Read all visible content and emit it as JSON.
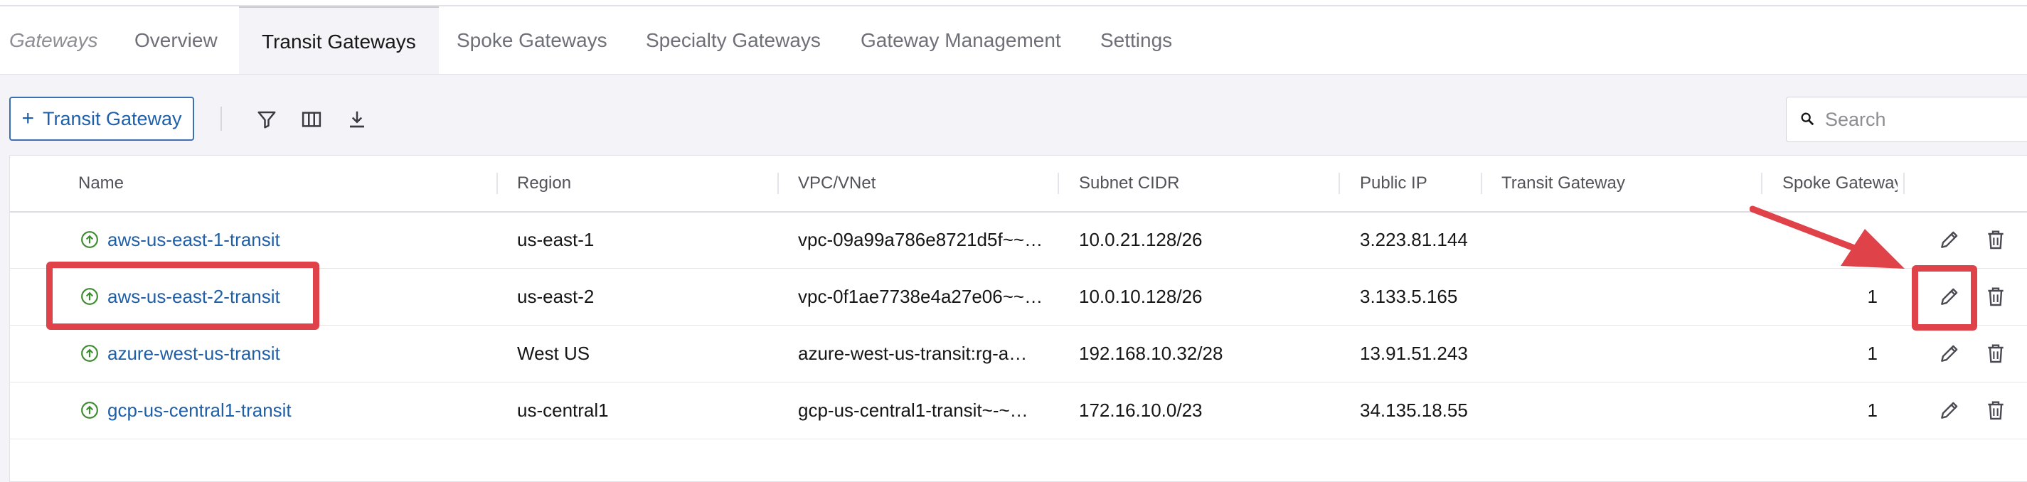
{
  "tabs": {
    "breadcrumb": "Gateways",
    "items": [
      {
        "label": "Overview"
      },
      {
        "label": "Transit Gateways"
      },
      {
        "label": "Spoke Gateways"
      },
      {
        "label": "Specialty Gateways"
      },
      {
        "label": "Gateway Management"
      },
      {
        "label": "Settings"
      }
    ],
    "active": "Transit Gateways"
  },
  "toolbar": {
    "add_label": "Transit Gateway",
    "add_icon": "plus-icon",
    "icons": [
      "filter-icon",
      "columns-icon",
      "download-icon"
    ],
    "search_placeholder": "Search"
  },
  "table": {
    "columns": [
      "Name",
      "Region",
      "VPC/VNet",
      "Subnet CIDR",
      "Public IP",
      "Transit Gateway",
      "Spoke Gateways"
    ],
    "rows": [
      {
        "name": "aws-us-east-1-transit",
        "region": "us-east-1",
        "vpc": "vpc-09a99a786e8721d5f~~…",
        "subnet": "10.0.21.128/26",
        "public_ip": "3.223.81.144",
        "transit_gateway": "",
        "spoke_gateways": "",
        "status": "up"
      },
      {
        "name": "aws-us-east-2-transit",
        "region": "us-east-2",
        "vpc": "vpc-0f1ae7738e4a27e06~~…",
        "subnet": "10.0.10.128/26",
        "public_ip": "3.133.5.165",
        "transit_gateway": "",
        "spoke_gateways": "1",
        "status": "up"
      },
      {
        "name": "azure-west-us-transit",
        "region": "West US",
        "vpc": "azure-west-us-transit:rg-a…",
        "subnet": "192.168.10.32/28",
        "public_ip": "13.91.51.243",
        "transit_gateway": "",
        "spoke_gateways": "1",
        "status": "up"
      },
      {
        "name": "gcp-us-central1-transit",
        "region": "us-central1",
        "vpc": "gcp-us-central1-transit~-~…",
        "subnet": "172.16.10.0/23",
        "public_ip": "34.135.18.55",
        "transit_gateway": "",
        "spoke_gateways": "1",
        "status": "up"
      }
    ],
    "row_actions": [
      "edit-icon",
      "delete-icon"
    ]
  },
  "colors": {
    "link": "#1f5fa8",
    "status_up": "#3d8b2f",
    "annotation": "#e0424a"
  }
}
